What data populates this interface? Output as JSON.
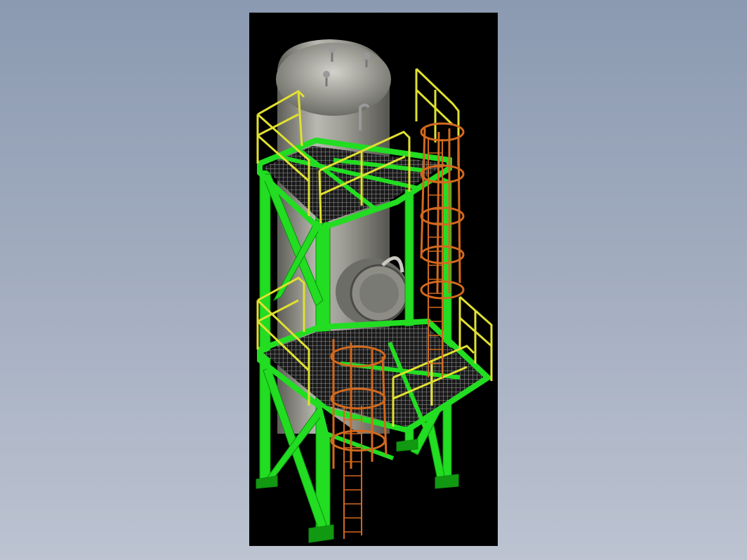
{
  "background": {
    "gradient_top": "#8b9ab1",
    "gradient_bottom": "#bcc3d1"
  },
  "viewport": {
    "background": "#000000"
  },
  "colors": {
    "structure": "#22dd22",
    "structure_dark": "#119911",
    "handrail": "#e0e030",
    "ladder": "#d2691e",
    "vessel": "#a8a8a0",
    "grating": "#c8c8c8"
  },
  "model": {
    "type": "3D CAD model",
    "components": [
      "vertical-pressure-vessel",
      "steel-frame",
      "upper-platform",
      "lower-platform",
      "caged-ladders",
      "handrails",
      "manway"
    ]
  }
}
